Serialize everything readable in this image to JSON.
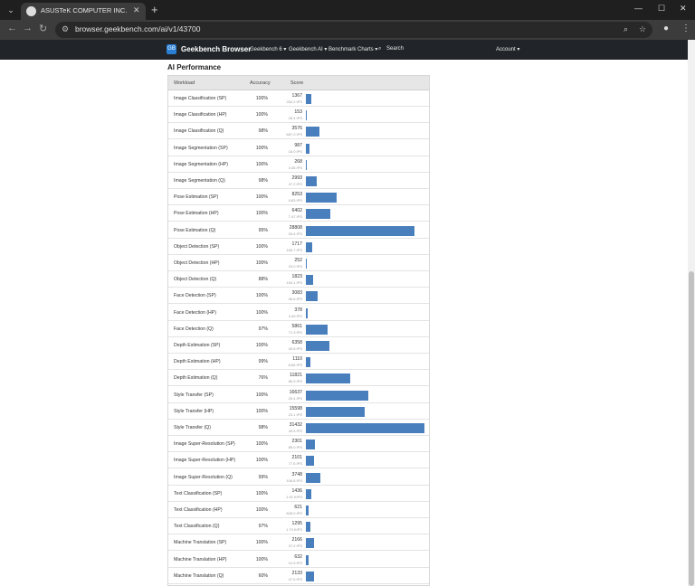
{
  "browser": {
    "tab_title": "ASUSTeK COMPUTER INC. RO",
    "url": "browser.geekbench.com/ai/v1/43700"
  },
  "site": {
    "logo_text": "Geekbench Browser",
    "nav": [
      "Geekbench 6 ▾",
      "Geekbench AI ▾",
      "Benchmark Charts ▾",
      "Search"
    ],
    "account": "Account ▾"
  },
  "section_title": "AI Performance",
  "columns": {
    "workload": "Workload",
    "accuracy": "Accuracy",
    "score": "Score"
  },
  "rows": [
    {
      "name": "Image Classification (SP)",
      "acc": "100%",
      "score": 1367,
      "ips": "254.2 IPS"
    },
    {
      "name": "Image Classification (HP)",
      "acc": "100%",
      "score": 153,
      "ips": "28.4 IPS"
    },
    {
      "name": "Image Classification (Q)",
      "acc": "98%",
      "score": 3576,
      "ips": "667.0 IPS"
    },
    {
      "name": "Image Segmentation (SP)",
      "acc": "100%",
      "score": 987,
      "ips": "16.0 IPS"
    },
    {
      "name": "Image Segmentation (HP)",
      "acc": "100%",
      "score": 268,
      "ips": "4.35 IPS"
    },
    {
      "name": "Image Segmentation (Q)",
      "acc": "98%",
      "score": 2993,
      "ips": "47.2 IPS"
    },
    {
      "name": "Pose Estimation (SP)",
      "acc": "100%",
      "score": 8253,
      "ips": "9.83 IPS"
    },
    {
      "name": "Pose Estimation (HP)",
      "acc": "100%",
      "score": 6402,
      "ips": "7.47 IPS"
    },
    {
      "name": "Pose Estimation (Q)",
      "acc": "95%",
      "score": 28808,
      "ips": "33.6 IPS"
    },
    {
      "name": "Object Detection (SP)",
      "acc": "100%",
      "score": 1717,
      "ips": "156.7 IPS"
    },
    {
      "name": "Object Detection (HP)",
      "acc": "100%",
      "score": 252,
      "ips": "23.0 IPS"
    },
    {
      "name": "Object Detection (Q)",
      "acc": "88%",
      "score": 1823,
      "ips": "154.1 IPS"
    },
    {
      "name": "Face Detection (SP)",
      "acc": "100%",
      "score": 3083,
      "ips": "36.6 IPS"
    },
    {
      "name": "Face Detection (HP)",
      "acc": "100%",
      "score": 378,
      "ips": "4.49 IPS"
    },
    {
      "name": "Face Detection (Q)",
      "acc": "97%",
      "score": 5861,
      "ips": "71.3 IPS"
    },
    {
      "name": "Depth Estimation (SP)",
      "acc": "100%",
      "score": 6358,
      "ips": "49.6 IPS"
    },
    {
      "name": "Depth Estimation (HP)",
      "acc": "99%",
      "score": 1110,
      "ips": "8.66 IPS"
    },
    {
      "name": "Depth Estimation (Q)",
      "acc": "76%",
      "score": 11821,
      "ips": "86.9 IPS"
    },
    {
      "name": "Style Transfer (SP)",
      "acc": "100%",
      "score": 16637,
      "ips": "25.4 IPS"
    },
    {
      "name": "Style Transfer (HP)",
      "acc": "100%",
      "score": 15598,
      "ips": "23.1 IPS"
    },
    {
      "name": "Style Transfer (Q)",
      "acc": "98%",
      "score": 31432,
      "ips": "49.5 IPS"
    },
    {
      "name": "Image Super-Resolution (SP)",
      "acc": "100%",
      "score": 2301,
      "ips": "85.0 IPS"
    },
    {
      "name": "Image Super-Resolution (HP)",
      "acc": "100%",
      "score": 2101,
      "ips": "77.6 IPS"
    },
    {
      "name": "Image Super-Resolution (Q)",
      "acc": "99%",
      "score": 3748,
      "ips": "108.8 IPS"
    },
    {
      "name": "Text Classification (SP)",
      "acc": "100%",
      "score": 1436,
      "ips": "1.92 KIPS"
    },
    {
      "name": "Text Classification (HP)",
      "acc": "100%",
      "score": 621,
      "ips": "828.0 IPS"
    },
    {
      "name": "Text Classification (Q)",
      "acc": "97%",
      "score": 1295,
      "ips": "1.73 KIPS"
    },
    {
      "name": "Machine Translation (SP)",
      "acc": "100%",
      "score": 2166,
      "ips": "37.2 IPS"
    },
    {
      "name": "Machine Translation (HP)",
      "acc": "100%",
      "score": 632,
      "ips": "10.9 IPS"
    },
    {
      "name": "Machine Translation (Q)",
      "acc": "60%",
      "score": 2133,
      "ips": "47.6 IPS"
    }
  ],
  "score_max": 31432
}
